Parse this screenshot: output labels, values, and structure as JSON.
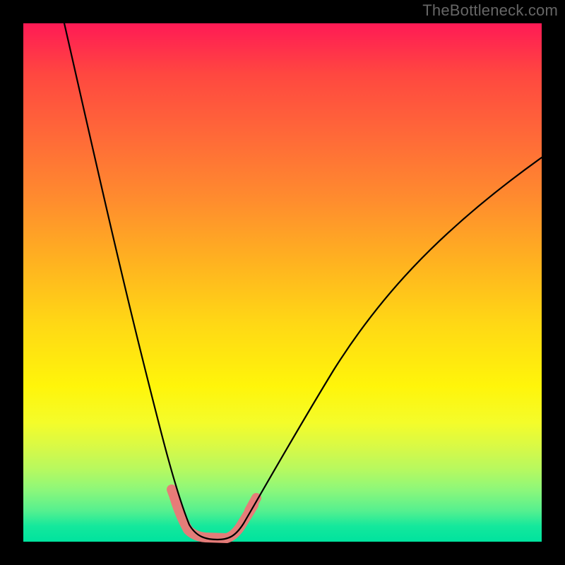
{
  "watermark": "TheBottleneck.com",
  "chart_data": {
    "type": "line",
    "title": "",
    "xlabel": "",
    "ylabel": "",
    "xlim": [
      0,
      100
    ],
    "ylim": [
      0,
      100
    ],
    "background_gradient": {
      "top": "#ff1a55",
      "bottom": "#00e39e",
      "description": "vertical red-to-green gradient"
    },
    "series": [
      {
        "name": "left-descending-arm",
        "x": [
          8,
          12,
          16,
          20,
          24,
          27,
          30,
          32,
          33
        ],
        "y": [
          100,
          80,
          60,
          40,
          22,
          10,
          3,
          1,
          0
        ]
      },
      {
        "name": "valley-floor",
        "x": [
          33,
          35,
          37,
          39,
          40
        ],
        "y": [
          0,
          0,
          0,
          0,
          0
        ]
      },
      {
        "name": "right-ascending-arm",
        "x": [
          40,
          44,
          50,
          58,
          68,
          80,
          92,
          100
        ],
        "y": [
          0,
          4,
          12,
          23,
          36,
          50,
          62,
          70
        ]
      },
      {
        "name": "salmon-highlight-band",
        "x": [
          29.5,
          31,
          33,
          35,
          37,
          39,
          40,
          42,
          44
        ],
        "y": [
          8,
          3,
          0.6,
          0.3,
          0.3,
          0.3,
          0.6,
          2.5,
          6
        ]
      }
    ],
    "annotations": []
  },
  "colors": {
    "frame": "#000000",
    "curve": "#000000",
    "highlight_band": "#e87a78",
    "watermark": "#666666"
  }
}
